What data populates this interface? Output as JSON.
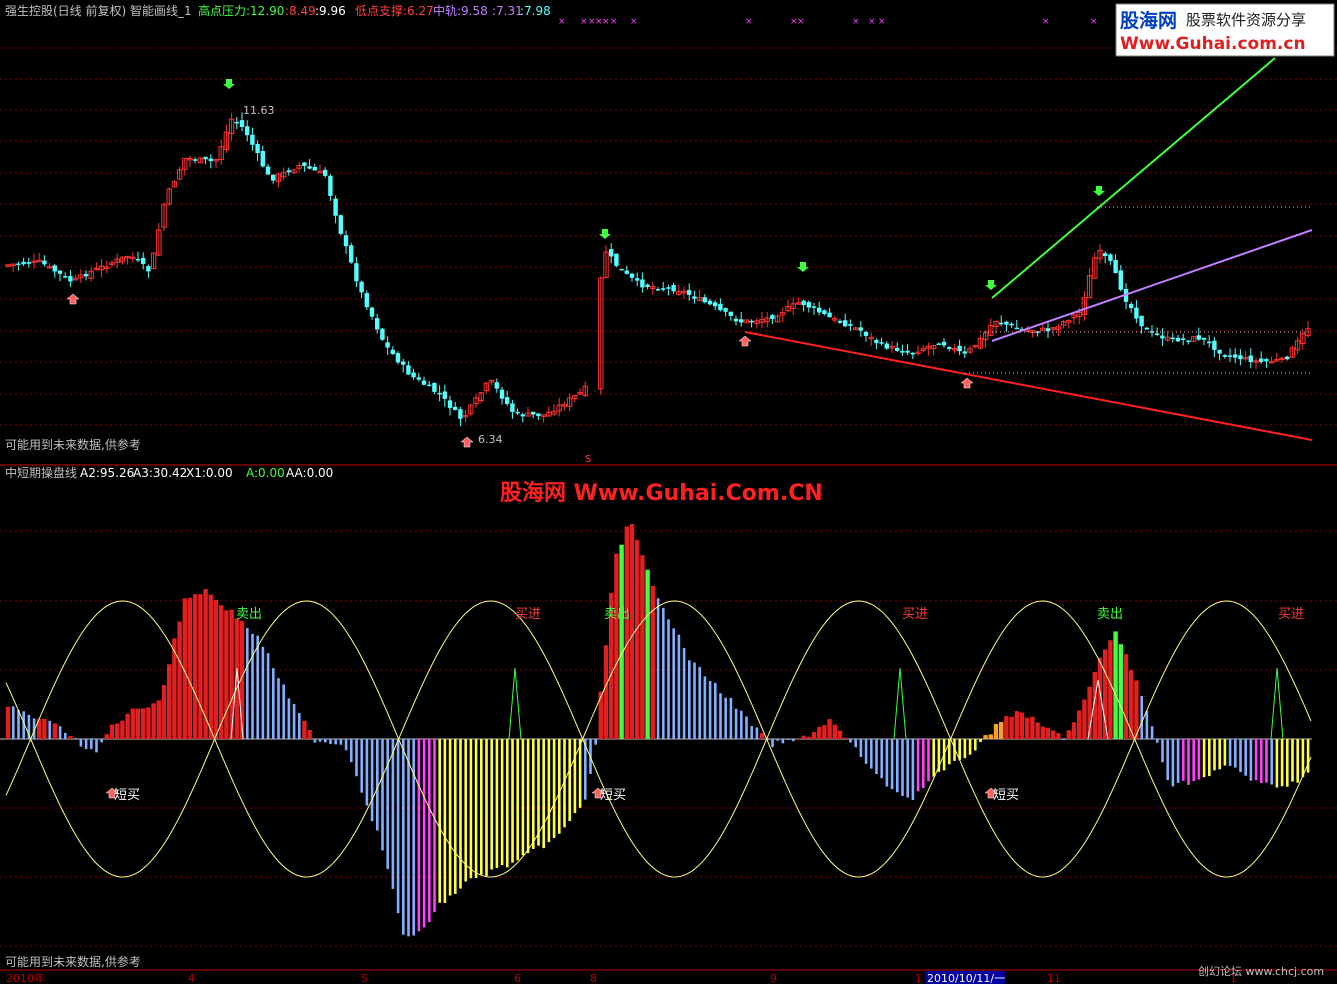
{
  "top_panel": {
    "title": "强生控股(日线 前复权) 智能画线_1",
    "high_label": "高点压力:12.90",
    "high_v2": ":8.49",
    "high_v3": ":9.96",
    "low_label": "低点支撑:6.27",
    "mid_label": "中轨:9.58",
    "mid_v2": ":7.31",
    "mid_v3": ":7.98",
    "peak_label": "11.63",
    "trough_label": "6.34",
    "warning": "可能用到未来数据,供参考",
    "s_marker": "S"
  },
  "bottom_panel": {
    "title": "中短期操盘线",
    "a2": "A2:95.26",
    "a3": "A3:30.42",
    "x1": "X1:0.00",
    "a": "A:0.00",
    "aa": "AA:0.00",
    "watermark": "股海网 Www.Guhai.Com.CN",
    "warning": "可能用到未来数据,供参考",
    "labels": {
      "sell": "卖出",
      "buy_in": "买进",
      "short_buy": "短买"
    }
  },
  "logo": {
    "name": "股海网",
    "slogan": "股票软件资源分享",
    "url": "Www.Guhai.com.cn"
  },
  "x_axis": {
    "ticks": [
      "2010年",
      "4",
      "5",
      "6",
      "8",
      "9",
      "1",
      "2010/10/11/一",
      "11",
      "1",
      "1"
    ]
  },
  "footer": {
    "credit": "创幻论坛 www.chcj.com"
  },
  "colors": {
    "up": "#ff3232",
    "down": "#54ffff",
    "grid": "#800000",
    "support": "#ff2020",
    "resistance": "#40ff40",
    "mid": "#c080ff",
    "sine": "#ffff80",
    "pos_bar": "#e02020",
    "neg_bar": "#ffff40",
    "magenta": "#ff40ff",
    "light_blue": "#80b0ff",
    "orange": "#ffa020"
  },
  "chart_data": [
    {
      "type": "candlestick",
      "title": "强生控股(日线 前复权)",
      "ylabel": "",
      "annotations": [
        "11.63",
        "6.34"
      ],
      "series": [
        {
          "name": "高点压力",
          "values": [
            12.9,
            8.49,
            9.96
          ]
        },
        {
          "name": "低点支撑",
          "values": [
            6.27
          ]
        },
        {
          "name": "中轨",
          "values": [
            9.58,
            7.31,
            7.98
          ]
        }
      ]
    },
    {
      "type": "bar",
      "title": "中短期操盘线",
      "series": [
        {
          "name": "A2",
          "values": [
            95.26
          ]
        },
        {
          "name": "A3",
          "values": [
            30.42
          ]
        },
        {
          "name": "X1",
          "values": [
            0.0
          ]
        },
        {
          "name": "A",
          "values": [
            0.0
          ]
        },
        {
          "name": "AA",
          "values": [
            0.0
          ]
        }
      ]
    }
  ]
}
